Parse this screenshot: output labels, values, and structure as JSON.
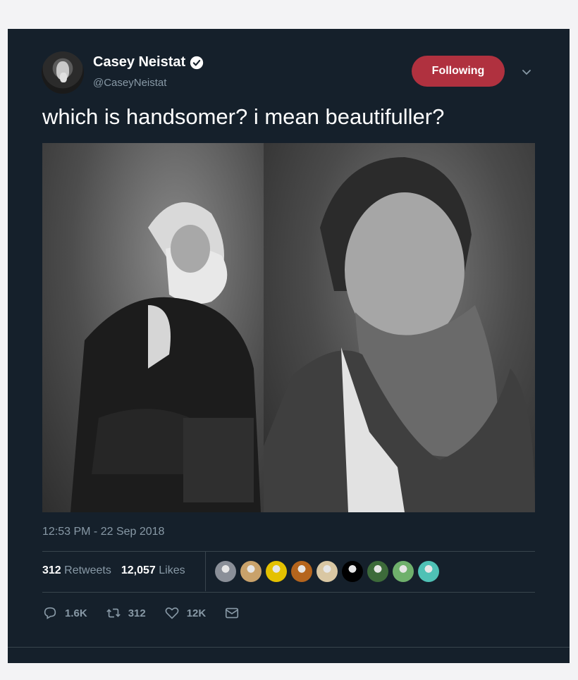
{
  "user": {
    "name": "Casey Neistat",
    "handle": "@CaseyNeistat"
  },
  "follow_button_label": "Following",
  "tweet": {
    "text": "which is handsomer?  i mean beautifuller?",
    "timestamp": "12:53 PM - 22 Sep 2018"
  },
  "stats": {
    "retweets_count": "312",
    "retweets_label": "Retweets",
    "likes_count": "12,057",
    "likes_label": "Likes"
  },
  "liker_avatars": [
    "#8a8f98",
    "#c9a26b",
    "#e4c100",
    "#b5651d",
    "#d9c7a3",
    "#000000",
    "#3d6b3a",
    "#6fb06c",
    "#4fc1b5"
  ],
  "actions": {
    "replies": "1.6K",
    "retweets": "312",
    "likes": "12K"
  },
  "colors": {
    "background": "#15202b",
    "follow_button": "#b0313f",
    "muted_text": "#8899a6"
  }
}
